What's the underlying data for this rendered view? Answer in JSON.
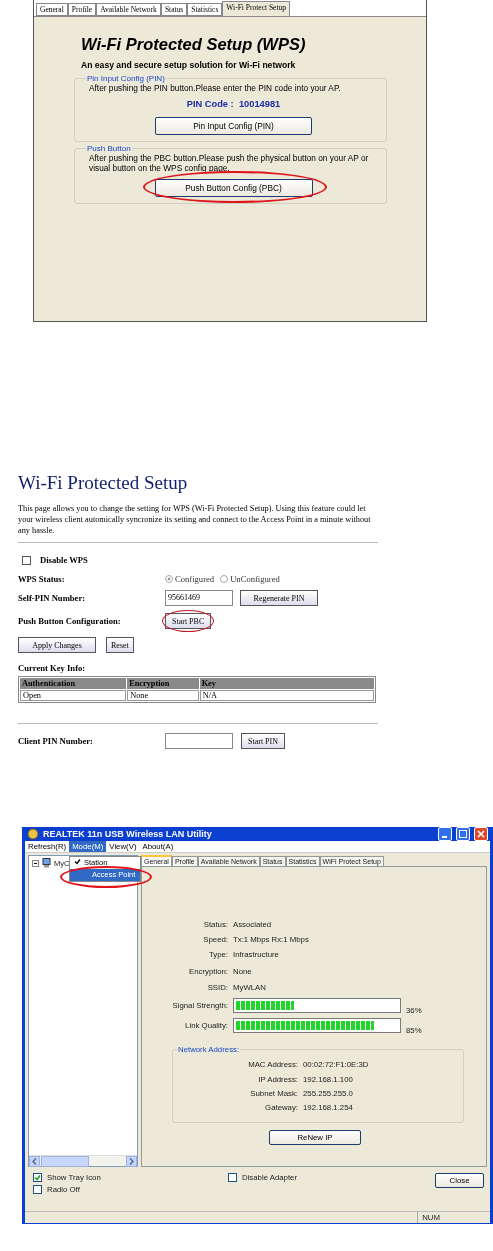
{
  "wps_utility": {
    "tabs": [
      {
        "label": "General",
        "selected": false
      },
      {
        "label": "Profile",
        "selected": false
      },
      {
        "label": "Available Network",
        "selected": false
      },
      {
        "label": "Status",
        "selected": false
      },
      {
        "label": "Statistics",
        "selected": false
      },
      {
        "label": "Wi-Fi Protect Setup",
        "selected": true
      }
    ],
    "title": "Wi-Fi Protected Setup (WPS)",
    "subtitle": "An easy and secure setup solution for Wi-Fi network",
    "pin_group": {
      "legend": "Pin Input Config (PIN)",
      "text": "After pushing the PIN button.Please enter the PIN code into your AP.",
      "pin_label": "PIN Code :",
      "pin_code": "10014981",
      "button": {
        "label": "Pin Input Config (PIN)",
        "circled": false
      }
    },
    "push_group": {
      "legend": "Push Button",
      "text": "After pushing the PBC button.Please push the physical button on your AP or visual button on the WPS config page.",
      "button": {
        "label": "Push Button Config (PBC)",
        "circled": true
      }
    }
  },
  "web_page": {
    "title": "Wi-Fi Protected Setup",
    "description": "This page allows you to change the setting for WPS (Wi-Fi Protected Setup). Using this feature could let your wireless client automically syncronize its setting and connect to the Access Point in a minute without any hassle.",
    "disable_wps": {
      "label": "Disable WPS",
      "checked": false
    },
    "wps_status": {
      "label": "WPS Status:",
      "options": [
        {
          "label": "Configured",
          "selected": true
        },
        {
          "label": "UnConfigured",
          "selected": false
        }
      ]
    },
    "self_pin": {
      "label": "Self-PIN Number:",
      "value": "95661469",
      "button": "Regenerate PIN"
    },
    "pbc": {
      "label": "Push Button Configuration:",
      "button": {
        "label": "Start PBC",
        "circled": true
      }
    },
    "buttons": [
      "Apply Changes",
      "Reset"
    ],
    "key_info": {
      "label": "Current Key Info:",
      "columns": [
        "Authentication",
        "Encryption",
        "Key"
      ],
      "rows": [
        [
          "Open",
          "None",
          "N/A"
        ]
      ]
    },
    "client_pin": {
      "label": "Client PIN Number:",
      "button": "Start PIN"
    }
  },
  "lan_utility": {
    "window_title": "REALTEK 11n USB Wireless LAN Utility",
    "menu": [
      {
        "label": "Refresh(R)",
        "selected": false
      },
      {
        "label": "Mode(M)",
        "selected": true
      },
      {
        "label": "View(V)",
        "selected": false
      },
      {
        "label": "About(A)",
        "selected": false
      }
    ],
    "tree_label": "MyC",
    "mode_menu": {
      "circled": true,
      "items": [
        {
          "label": "Station",
          "checked": true,
          "selected": false
        },
        {
          "label": "Access Point",
          "checked": false,
          "selected": true
        }
      ]
    },
    "tabs": [
      {
        "label": "General",
        "selected": true
      },
      {
        "label": "Profile",
        "selected": false
      },
      {
        "label": "Available Network",
        "selected": false
      },
      {
        "label": "Status",
        "selected": false
      },
      {
        "label": "Statistics",
        "selected": false
      },
      {
        "label": "WiFi Protect Setup",
        "selected": false
      }
    ],
    "fields": [
      {
        "label": "Status:",
        "value": "Associated"
      },
      {
        "label": "Speed:",
        "value": "Tx:1 Mbps Rx:1 Mbps"
      },
      {
        "label": "Type:",
        "value": "Infrastructure"
      },
      {
        "label": "Encryption:",
        "value": "None"
      },
      {
        "label": "SSID:",
        "value": "MyWLAN"
      }
    ],
    "meters": [
      {
        "label": "Signal Strength:",
        "level": 0.36,
        "reading": "36%"
      },
      {
        "label": "Link Quality:",
        "level": 0.85,
        "reading": "85%"
      }
    ],
    "network_group": {
      "legend": "Network Address:",
      "fields": [
        {
          "label": "MAC Address:",
          "value": "00:02:72:F1:0E:3D"
        },
        {
          "label": "IP Address:",
          "value": "192.168.1.100"
        },
        {
          "label": "Subnet Mask:",
          "value": "255.255.255.0"
        },
        {
          "label": "Gateway:",
          "value": "192.168.1.254"
        }
      ]
    },
    "renew_button": "ReNew IP",
    "options": [
      {
        "label": "Show Tray Icon",
        "checked": true
      },
      {
        "label": "Radio Off",
        "checked": false
      },
      {
        "label": "Disable Adapter",
        "checked": false
      }
    ],
    "close_button": "Close",
    "status_bar": "NUM"
  }
}
